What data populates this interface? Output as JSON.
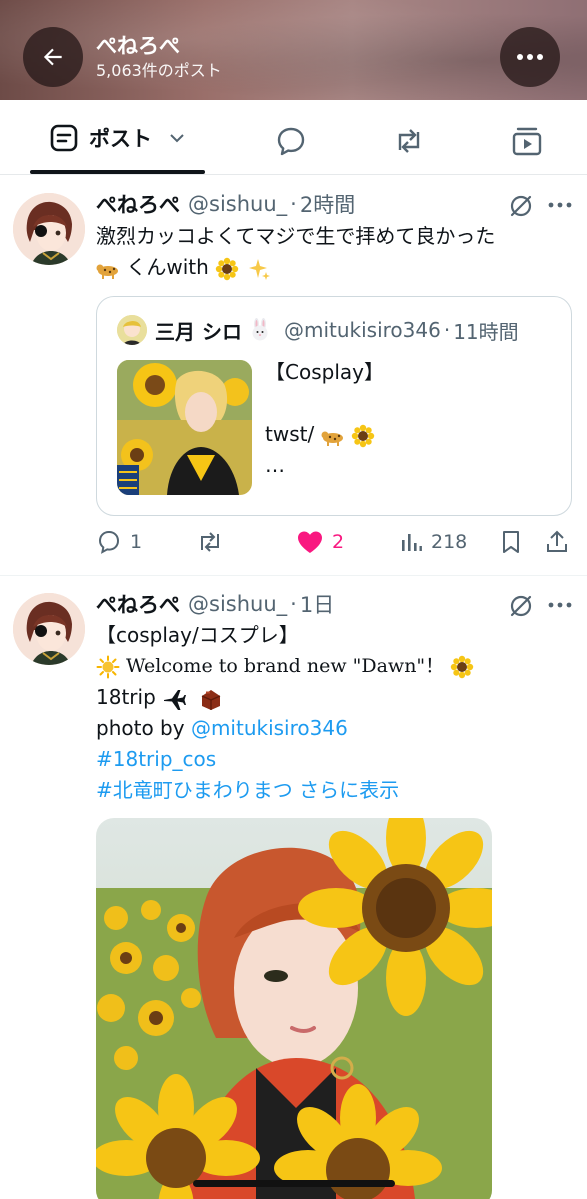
{
  "header": {
    "title": "ぺねろぺ",
    "post_count": "5,063件のポスト"
  },
  "tabs": {
    "active_label": "ポスト",
    "items": [
      "posts",
      "replies",
      "reposts",
      "media"
    ]
  },
  "tweets": [
    {
      "name": "ぺねろぺ",
      "handle": "@sishuu_",
      "dot": "·",
      "time": "2時間",
      "text_line1": "激烈カッコよくてマジで生で拝めて良かった",
      "text_line2": "くんwith",
      "quote": {
        "name": "三月 シロ",
        "handle": "@mitukisiro346",
        "time": "11時間",
        "line1": "【Cosplay】",
        "line2": "twst/",
        "line3": "…"
      },
      "actions": {
        "replies": "1",
        "reposts": "",
        "likes": "2",
        "views": "218"
      }
    },
    {
      "name": "ぺねろぺ",
      "handle": "@sishuu_",
      "dot": "·",
      "time": "1日",
      "line1": "【cosplay/コスプレ】",
      "line2": "Welcome to brand new \"Dawn\"！",
      "line3": "18trip",
      "line4_prefix": "photo by ",
      "line4_link": "@mitukisiro346",
      "line5": "#18trip_cos",
      "line6_tag": "#北竜町ひまわりまつ",
      "line6_more": "さらに表示"
    }
  ],
  "colors": {
    "accent": "#1d9bf0",
    "like": "#f91880",
    "muted": "#536471",
    "text": "#0f1419"
  }
}
